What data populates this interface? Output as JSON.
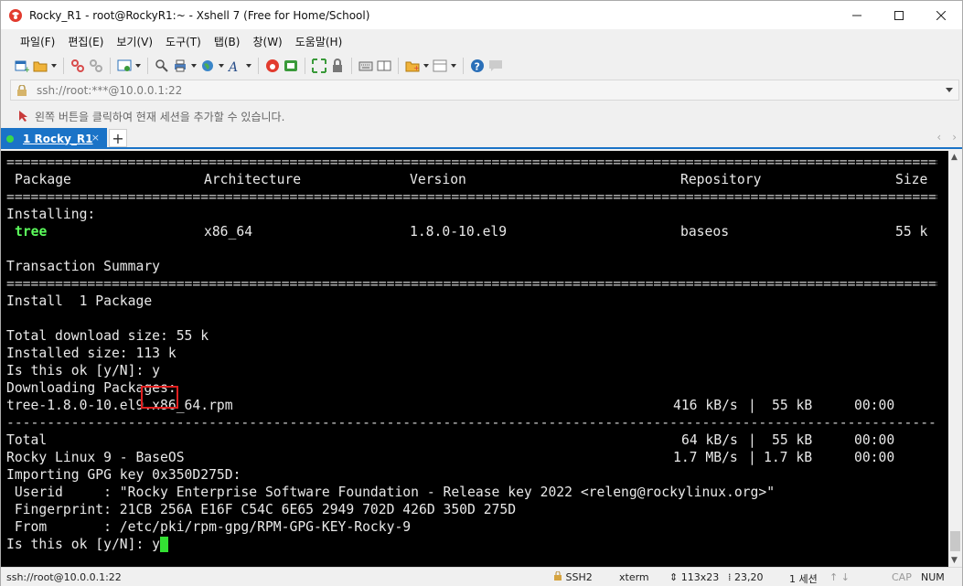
{
  "window": {
    "title": "Rocky_R1 - root@RockyR1:~ - Xshell 7 (Free for Home/School)"
  },
  "menu": [
    "파일(F)",
    "편집(E)",
    "보기(V)",
    "도구(T)",
    "탭(B)",
    "창(W)",
    "도움말(H)"
  ],
  "address": {
    "value": "ssh://root:***@10.0.0.1:22"
  },
  "hint": {
    "text": "왼쪽 버튼을 클릭하여 현재 세션을 추가할 수 있습니다."
  },
  "tabs": [
    {
      "label": "1 Rocky_R1",
      "close": "×"
    }
  ],
  "tab_add_label": "+",
  "terminal": {
    "separator": "==========================================================================================================================================",
    "dash_separator": "------------------------------------------------------------------------------------------------------------------------------------------",
    "header": {
      "package": "Package",
      "arch": "Architecture",
      "version": "Version",
      "repo": "Repository",
      "size": "Size"
    },
    "installing_label": "Installing:",
    "pkg_row": {
      "name": "tree",
      "arch": "x86_64",
      "version": "1.8.0-10.el9",
      "repo": "baseos",
      "size": "55 k"
    },
    "summary_title": "Transaction Summary",
    "install_line": "Install  1 Package",
    "download_size": "Total download size: 55 k",
    "installed_size": "Installed size: 113 k",
    "confirm1": "Is this ok [y/N]: y",
    "downloading": "Downloading Packages:",
    "rpm_row": {
      "file": "tree-1.8.0-10.el9.x86_64.rpm",
      "speed": "416 kB/s",
      "sep": "|",
      "size": "55 kB",
      "time": "00:00"
    },
    "total_row": {
      "label": "Total",
      "speed": "64 kB/s",
      "sep": "|",
      "size": "55 kB",
      "time": "00:00"
    },
    "repo_row": {
      "label": "Rocky Linux 9 - BaseOS",
      "speed": "1.7 MB/s",
      "sep": "|",
      "size": "1.7 kB",
      "time": "00:00"
    },
    "gpg_import": "Importing GPG key 0x350D275D:",
    "userid": " Userid     : \"Rocky Enterprise Software Foundation - Release key 2022 <releng@rockylinux.org>\"",
    "fingerprint": " Fingerprint: 21CB 256A E16F C54C 6E65 2949 702D 426D 350D 275D",
    "from": " From       : /etc/pki/rpm-gpg/RPM-GPG-KEY-Rocky-9",
    "prompt": "Is this ok [y/N]: ",
    "typed": "y"
  },
  "status": {
    "connection": "ssh://root@10.0.0.1:22",
    "protocol": "SSH2",
    "terminal": "xterm",
    "size": "113x23",
    "position": "23,20",
    "sessions": "1 세션",
    "caps": "CAP",
    "num": "NUM"
  },
  "colors": {
    "tab_active": "#1a73c7",
    "terminal_bg": "#000000",
    "package_green": "#5cff5c",
    "cursor": "#33e033",
    "highlight_box": "#e02020"
  }
}
